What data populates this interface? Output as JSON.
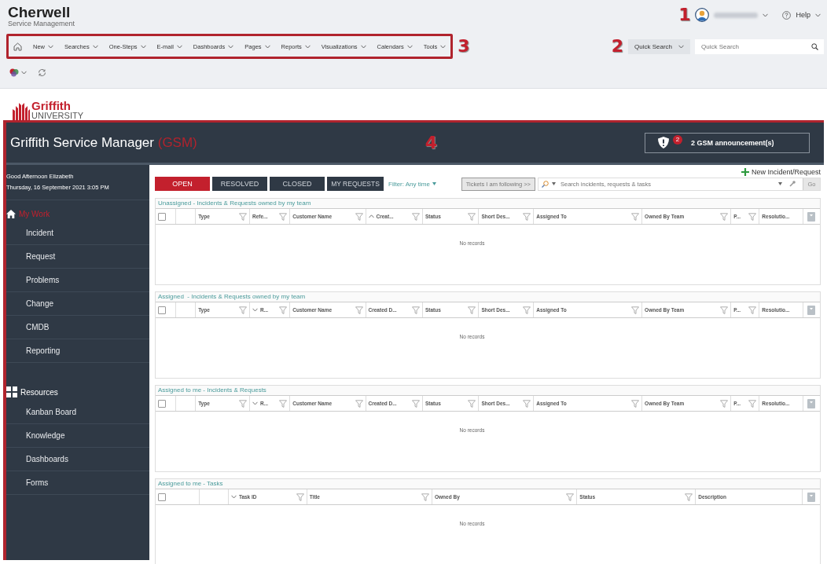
{
  "brand": {
    "name": "Cherwell",
    "subtitle": "Service Management"
  },
  "nav": {
    "items": [
      "New",
      "Searches",
      "One-Steps",
      "E-mail",
      "Dashboards",
      "Pages",
      "Reports",
      "Visualizations",
      "Calendars",
      "Tools"
    ]
  },
  "callouts": [
    "1",
    "2",
    "3",
    "4"
  ],
  "user_menu": {
    "help": "Help"
  },
  "quick_search": {
    "scope": "Quick Search",
    "placeholder": "Quick Search"
  },
  "logo": {
    "name": "Griffith",
    "subtitle": "UNIVERSITY"
  },
  "app_header": {
    "title": "Griffith Service Manager",
    "suffix": "(GSM)",
    "announcement_badge": "2",
    "announcement": "2 GSM announcement(s)"
  },
  "sidebar": {
    "greeting": "Good Afternoon Elizabeth",
    "date": "Thursday, 16 September 2021 3:05 PM",
    "sections": [
      {
        "title": "My Work",
        "kind": "home",
        "selected": true,
        "items": [
          "Incident",
          "Request",
          "Problems",
          "Change",
          "CMDB",
          "Reporting"
        ]
      },
      {
        "title": "Resources",
        "kind": "grid",
        "selected": false,
        "items": [
          "Kanban Board",
          "Knowledge",
          "Dashboards",
          "Forms"
        ]
      }
    ]
  },
  "tabs": [
    {
      "label": "OPEN",
      "selected": true
    },
    {
      "label": "RESOLVED",
      "selected": false
    },
    {
      "label": "CLOSED",
      "selected": false
    },
    {
      "label": "MY REQUESTS",
      "selected": false
    }
  ],
  "filter": "Filter: Any time",
  "new_button": "New Incident/Request",
  "toolbar": {
    "following": "Tickets I am following >>",
    "search_placeholder": "Search incidents, requests & tasks",
    "go": "Go"
  },
  "grids": [
    {
      "title": "Unassigned - Incidents & Requests owned by my team",
      "kind": "tickets",
      "checked": false,
      "empty": "No records",
      "columns": [
        {
          "label": "Type",
          "sort_ascending": false,
          "sort_descending": false,
          "filter": true
        },
        {
          "label": "Refe...",
          "sort_ascending": false,
          "sort_descending": false,
          "filter": true
        },
        {
          "label": "Customer Name",
          "sort_ascending": false,
          "sort_descending": false,
          "filter": true
        },
        {
          "label": "Creat...",
          "sort_ascending": true,
          "sort_descending": false,
          "filter": true
        },
        {
          "label": "Status",
          "sort_ascending": false,
          "sort_descending": false,
          "filter": true
        },
        {
          "label": "Short Des...",
          "sort_ascending": false,
          "sort_descending": false,
          "filter": true
        },
        {
          "label": "Assigned To",
          "sort_ascending": false,
          "sort_descending": false,
          "filter": true
        },
        {
          "label": "Owned By Team",
          "sort_ascending": false,
          "sort_descending": false,
          "filter": true
        },
        {
          "label": "P...",
          "sort_ascending": false,
          "sort_descending": false,
          "filter": true
        },
        {
          "label": "Resolutio...",
          "sort_ascending": false,
          "sort_descending": false,
          "filter": false
        }
      ]
    },
    {
      "title": "Assigned  - Incidents & Requests owned by my team",
      "kind": "tickets",
      "checked": false,
      "empty": "No records",
      "columns": [
        {
          "label": "Type",
          "sort_ascending": false,
          "sort_descending": false,
          "filter": true
        },
        {
          "label": "R...",
          "sort_ascending": false,
          "sort_descending": true,
          "filter": true
        },
        {
          "label": "Customer Name",
          "sort_ascending": false,
          "sort_descending": false,
          "filter": true
        },
        {
          "label": "Created D...",
          "sort_ascending": false,
          "sort_descending": false,
          "filter": true
        },
        {
          "label": "Status",
          "sort_ascending": false,
          "sort_descending": false,
          "filter": true
        },
        {
          "label": "Short Des...",
          "sort_ascending": false,
          "sort_descending": false,
          "filter": true
        },
        {
          "label": "Assigned To",
          "sort_ascending": false,
          "sort_descending": false,
          "filter": true
        },
        {
          "label": "Owned By Team",
          "sort_ascending": false,
          "sort_descending": false,
          "filter": true
        },
        {
          "label": "P...",
          "sort_ascending": false,
          "sort_descending": false,
          "filter": true
        },
        {
          "label": "Resolutio...",
          "sort_ascending": false,
          "sort_descending": false,
          "filter": false
        }
      ]
    },
    {
      "title": "Assigned to me - Incidents & Requests",
      "kind": "tickets",
      "checked": false,
      "empty": "No records",
      "columns": [
        {
          "label": "Type",
          "sort_ascending": false,
          "sort_descending": false,
          "filter": true
        },
        {
          "label": "R...",
          "sort_ascending": false,
          "sort_descending": true,
          "filter": true
        },
        {
          "label": "Customer Name",
          "sort_ascending": false,
          "sort_descending": false,
          "filter": true
        },
        {
          "label": "Created D...",
          "sort_ascending": false,
          "sort_descending": false,
          "filter": true
        },
        {
          "label": "Status",
          "sort_ascending": false,
          "sort_descending": false,
          "filter": true
        },
        {
          "label": "Short Des...",
          "sort_ascending": false,
          "sort_descending": false,
          "filter": true
        },
        {
          "label": "Assigned To",
          "sort_ascending": false,
          "sort_descending": false,
          "filter": true
        },
        {
          "label": "Owned By Team",
          "sort_ascending": false,
          "sort_descending": false,
          "filter": true
        },
        {
          "label": "P...",
          "sort_ascending": false,
          "sort_descending": false,
          "filter": true
        },
        {
          "label": "Resolutio...",
          "sort_ascending": false,
          "sort_descending": false,
          "filter": false
        }
      ]
    },
    {
      "title": "Assigned to me - Tasks",
      "kind": "tasks",
      "checked": false,
      "empty": "No records",
      "columns": [
        {
          "label": "Task ID",
          "sort_ascending": false,
          "sort_descending": true,
          "filter": true
        },
        {
          "label": "Title",
          "sort_ascending": false,
          "sort_descending": false,
          "filter": true
        },
        {
          "label": "Owned By",
          "sort_ascending": false,
          "sort_descending": false,
          "filter": true
        },
        {
          "label": "Status",
          "sort_ascending": false,
          "sort_descending": false,
          "filter": true
        },
        {
          "label": "Description",
          "sort_ascending": false,
          "sort_descending": false,
          "filter": false
        }
      ]
    }
  ]
}
